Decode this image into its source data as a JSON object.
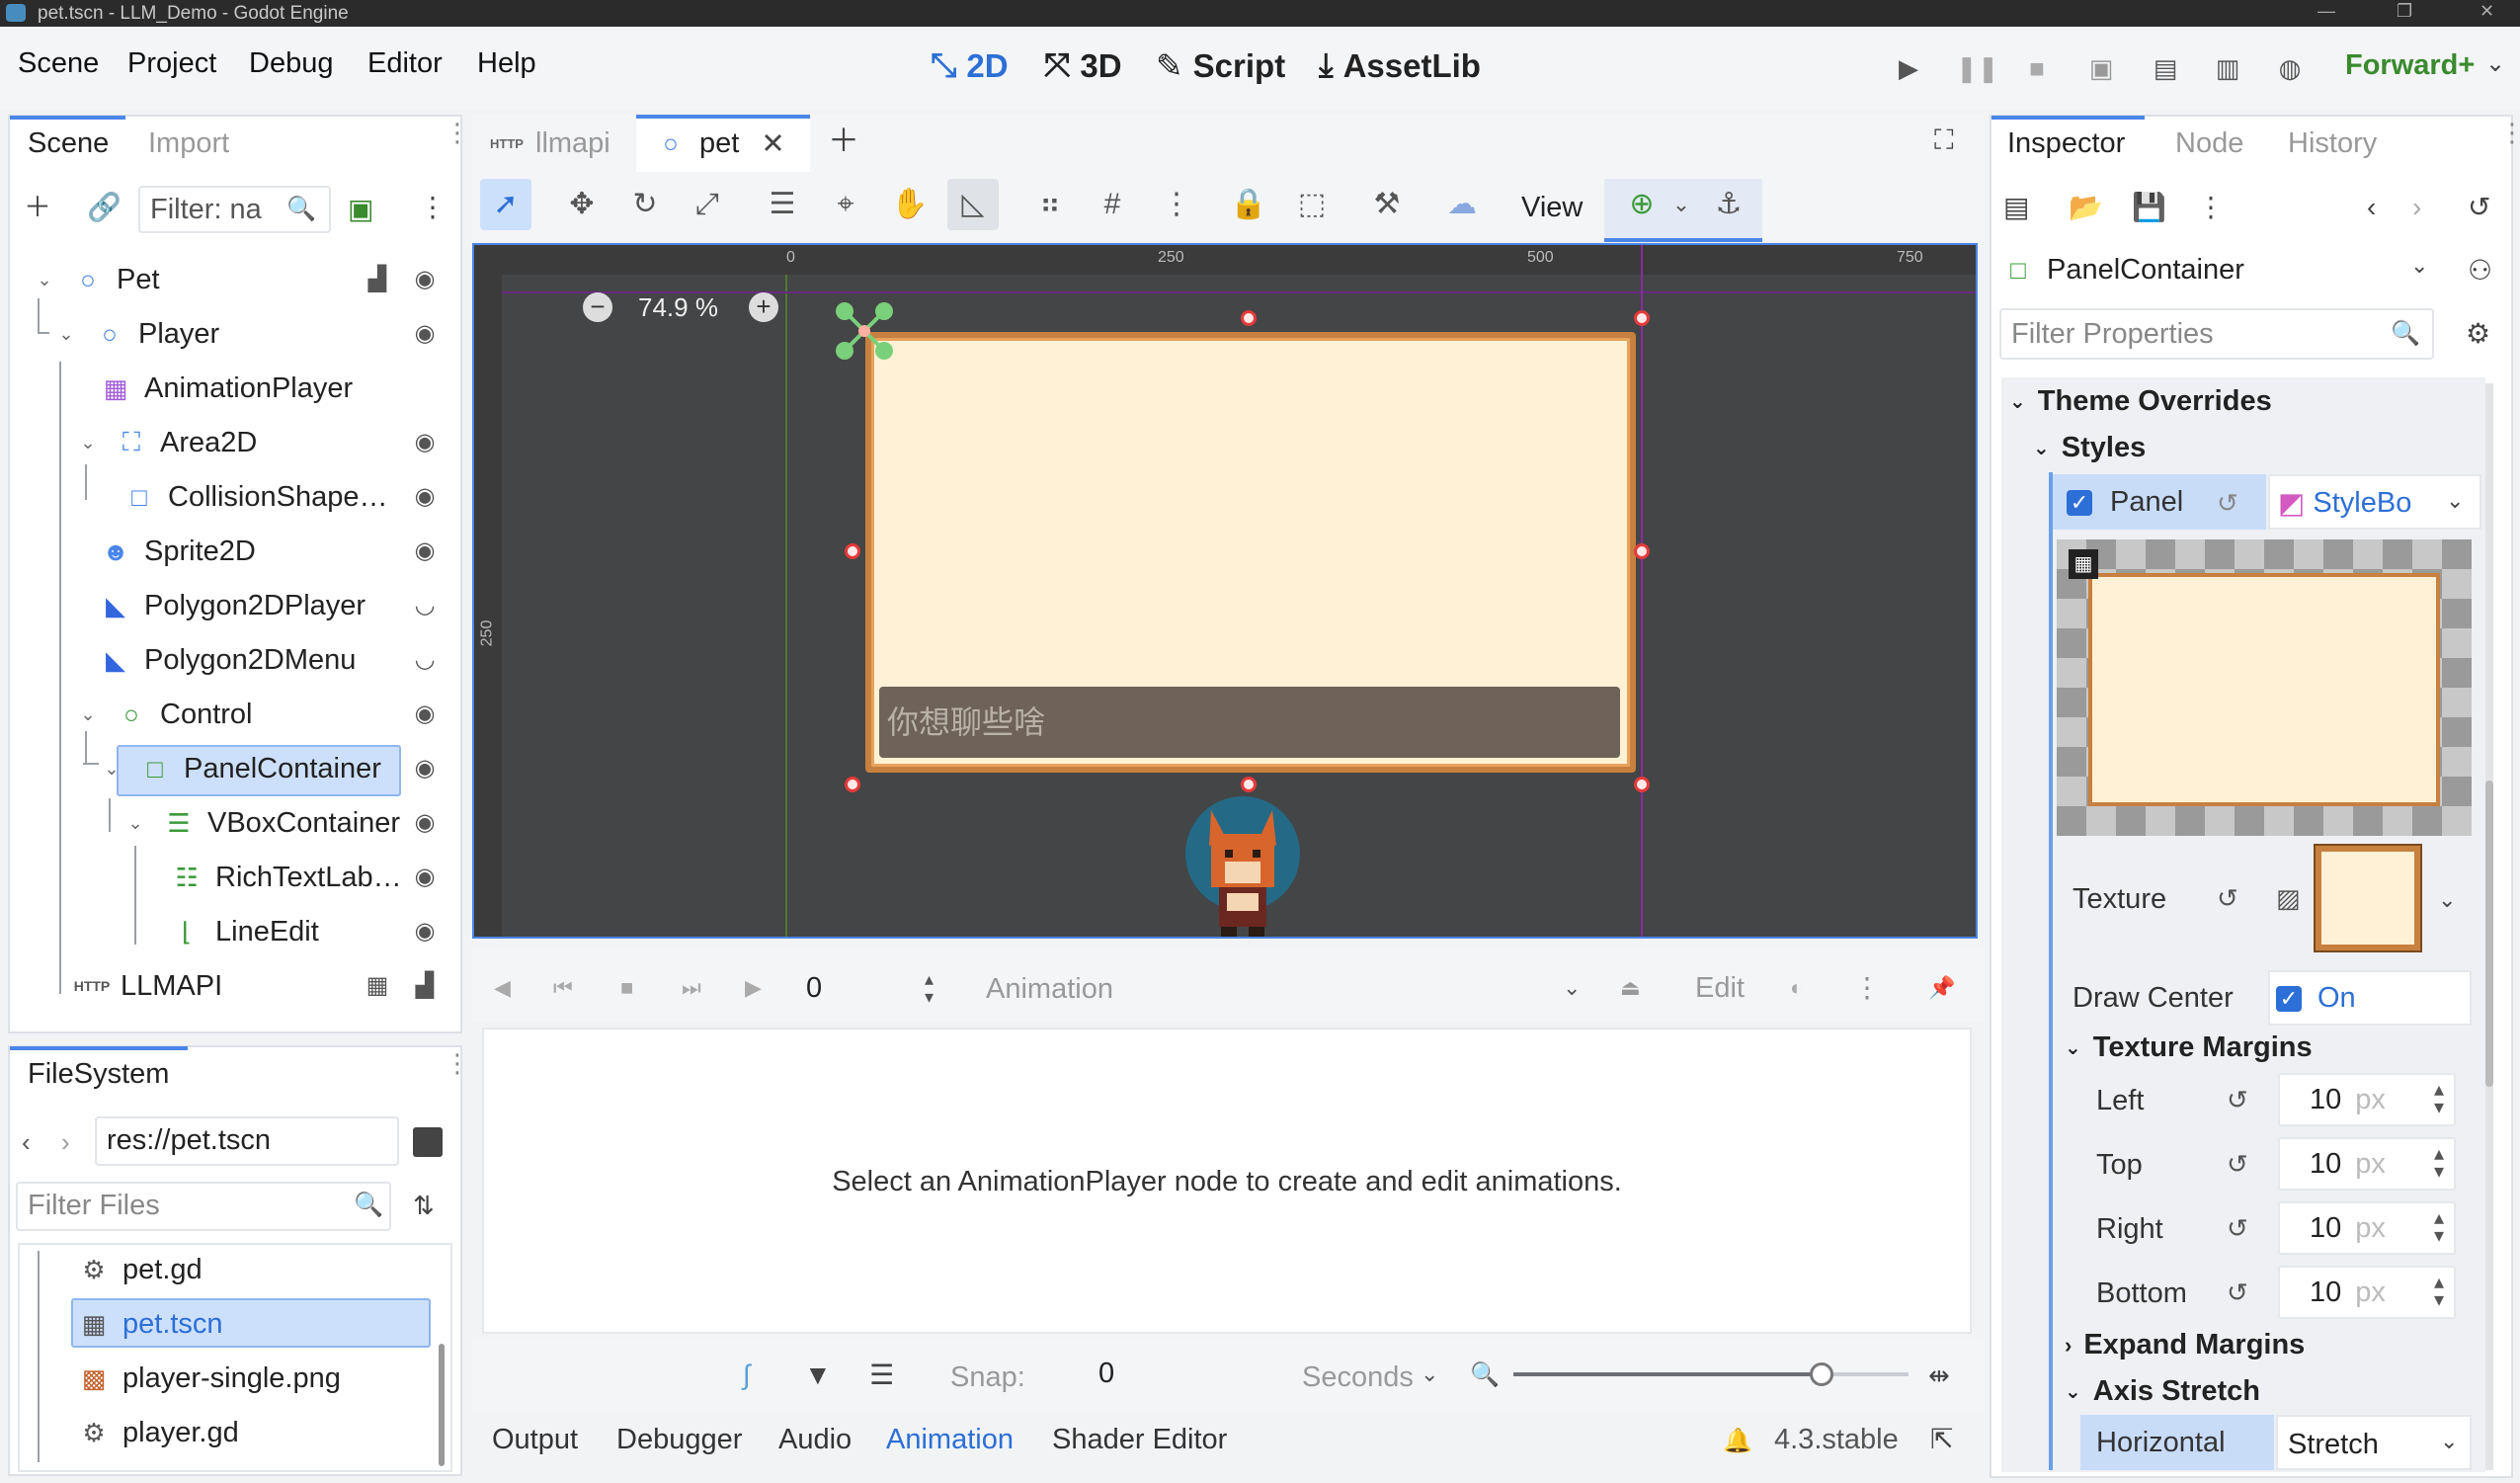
{
  "window": {
    "title": "pet.tscn - LLM_Demo - Godot Engine",
    "controls": [
      "—",
      "❐",
      "✕"
    ]
  },
  "menu": {
    "items": [
      "Scene",
      "Project",
      "Debug",
      "Editor",
      "Help"
    ]
  },
  "workspaces": {
    "2d": "2D",
    "3d": "3D",
    "script": "Script",
    "assetlib": "AssetLib"
  },
  "renderer": "Forward+",
  "scene_dock": {
    "tabs": [
      "Scene",
      "Import"
    ],
    "filter_placeholder": "Filter: na",
    "nodes": [
      {
        "label": "Pet",
        "icon": "node2d-icon"
      },
      {
        "label": "Player",
        "icon": "node2d-icon"
      },
      {
        "label": "AnimationPlayer",
        "icon": "animation-player-icon"
      },
      {
        "label": "Area2D",
        "icon": "area2d-icon"
      },
      {
        "label": "CollisionShape…",
        "icon": "collision-shape-icon"
      },
      {
        "label": "Sprite2D",
        "icon": "sprite2d-icon"
      },
      {
        "label": "Polygon2DPlayer",
        "icon": "polygon2d-icon"
      },
      {
        "label": "Polygon2DMenu",
        "icon": "polygon2d-icon"
      },
      {
        "label": "Control",
        "icon": "control-icon"
      },
      {
        "label": "PanelContainer",
        "icon": "panel-container-icon"
      },
      {
        "label": "VBoxContainer",
        "icon": "vbox-container-icon"
      },
      {
        "label": "RichTextLab…",
        "icon": "rich-text-label-icon"
      },
      {
        "label": "LineEdit",
        "icon": "line-edit-icon"
      },
      {
        "label": "LLMAPI",
        "icon": "http-request-icon"
      }
    ]
  },
  "filesystem": {
    "tab": "FileSystem",
    "path": "res://pet.tscn",
    "filter_placeholder": "Filter Files",
    "files": [
      {
        "label": "pet.gd",
        "icon": "gear-icon"
      },
      {
        "label": "pet.tscn",
        "icon": "clapper-icon"
      },
      {
        "label": "player-single.png",
        "icon": "image-icon"
      },
      {
        "label": "player.gd",
        "icon": "gear-icon"
      }
    ]
  },
  "editor_tabs": [
    {
      "label": "llmapi",
      "prefix": "HTTP"
    },
    {
      "label": "pet"
    }
  ],
  "canvas": {
    "zoom": "74.9 %",
    "view_label": "View",
    "ruler_top": [
      "0",
      "250",
      "500",
      "750"
    ],
    "ruler_left": [
      "250"
    ],
    "line_edit_placeholder": "你想聊些啥"
  },
  "animation": {
    "time": "0",
    "name_placeholder": "Animation",
    "edit": "Edit",
    "empty_message": "Select an AnimationPlayer node to create and edit animations.",
    "snap_label": "Snap:",
    "snap_value": "0",
    "unit": "Seconds",
    "zoom_fraction": 0.78
  },
  "bottom_tabs": [
    "Output",
    "Debugger",
    "Audio",
    "Animation",
    "Shader Editor"
  ],
  "version": "4.3.stable",
  "inspector": {
    "tabs": [
      "Inspector",
      "Node",
      "History"
    ],
    "class_name": "PanelContainer",
    "filter_placeholder": "Filter Properties",
    "section": "Theme Overrides",
    "subsection": "Styles",
    "panel_label": "Panel",
    "stylebox": "StyleBo",
    "texture_label": "Texture",
    "draw_center_label": "Draw Center",
    "draw_center_value": "On",
    "texture_margins": "Texture Margins",
    "margins": [
      {
        "label": "Left",
        "value": "10",
        "unit": "px"
      },
      {
        "label": "Top",
        "value": "10",
        "unit": "px"
      },
      {
        "label": "Right",
        "value": "10",
        "unit": "px"
      },
      {
        "label": "Bottom",
        "value": "10",
        "unit": "px"
      }
    ],
    "expand_margins": "Expand Margins",
    "axis_stretch": "Axis Stretch",
    "horizontal_label": "Horizontal",
    "horizontal_value": "Stretch"
  },
  "colors": {
    "accent": "#4a86e8",
    "viewport": "#444546",
    "panel_fill": "#fff1d6",
    "panel_border": "#c7803f",
    "handle": "#e53a3a"
  }
}
